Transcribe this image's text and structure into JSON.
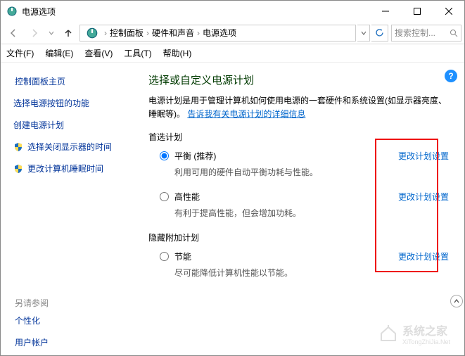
{
  "window": {
    "title": "电源选项"
  },
  "nav": {
    "crumbs": [
      "控制面板",
      "硬件和声音",
      "电源选项"
    ],
    "search_placeholder": "搜索控制..."
  },
  "menu": {
    "file": "文件(F)",
    "edit": "编辑(E)",
    "view": "查看(V)",
    "tools": "工具(T)",
    "help": "帮助(H)"
  },
  "sidebar": {
    "home": "控制面板主页",
    "links": [
      {
        "label": "选择电源按钮的功能",
        "shield": false
      },
      {
        "label": "创建电源计划",
        "shield": false
      },
      {
        "label": "选择关闭显示器的时间",
        "shield": true
      },
      {
        "label": "更改计算机睡眠时间",
        "shield": true
      }
    ],
    "also_see": "另请参阅",
    "also_links": [
      "个性化",
      "用户帐户"
    ]
  },
  "main": {
    "heading": "选择或自定义电源计划",
    "desc_pre": "电源计划是用于管理计算机如何使用电源的一套硬件和系统设置(如显示器亮度、睡眠等)。",
    "desc_link": "告诉我有关电源计划的详细信息",
    "preferred_label": "首选计划",
    "hidden_label": "隐藏附加计划",
    "change_link": "更改计划设置",
    "plans": {
      "balanced": {
        "name": "平衡 (推荐)",
        "desc": "利用可用的硬件自动平衡功耗与性能。"
      },
      "high": {
        "name": "高性能",
        "desc": "有利于提高性能，但会增加功耗。"
      },
      "saver": {
        "name": "节能",
        "desc": "尽可能降低计算机性能以节能。"
      }
    }
  },
  "watermark": {
    "text": "系统之家",
    "sub": "XiTongZhiJia.Net"
  }
}
